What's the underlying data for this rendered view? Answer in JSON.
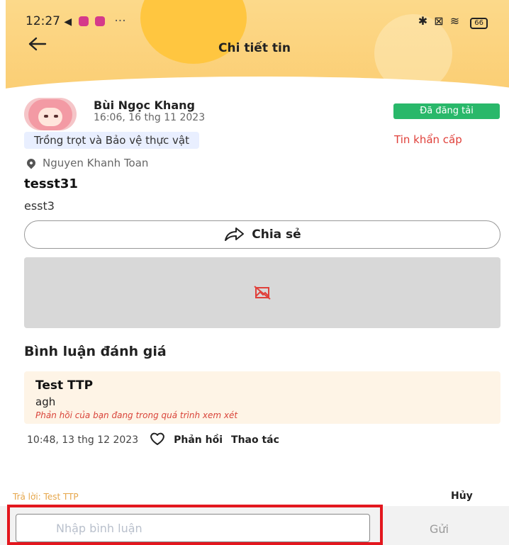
{
  "status_bar": {
    "time": "12:27",
    "battery": "66"
  },
  "header": {
    "title": "Chi tiết tin"
  },
  "post": {
    "author": "Bùi Ngọc Khang",
    "time": "16:06, 16 thg 11 2023",
    "status_badge": "Đã đăng tải",
    "category": "Trồng trọt và Bảo vệ thực vật",
    "urgent_label": "Tin khẩn cấp",
    "location": "Nguyen Khanh Toan",
    "title": "tesst31",
    "body": "esst3",
    "share_label": "Chia sẻ"
  },
  "comments": {
    "section_title": "Bình luận đánh giá",
    "items": [
      {
        "author": "Test TTP",
        "text": "agh",
        "note": "Phản hồi của bạn đang trong quá trình xem xét",
        "time": "10:48, 13 thg 12 2023",
        "reply_label": "Phản hồi",
        "actions_label": "Thao tác"
      }
    ]
  },
  "reply_bar": {
    "reply_to": "Trả lời: Test TTP",
    "cancel_label": "Hủy",
    "input_placeholder": "Nhập bình luận",
    "send_label": "Gửi"
  },
  "colors": {
    "accent": "#fbcd72",
    "badge": "#29b86a",
    "urgent": "#e0403a",
    "highlight": "#e3171e"
  }
}
